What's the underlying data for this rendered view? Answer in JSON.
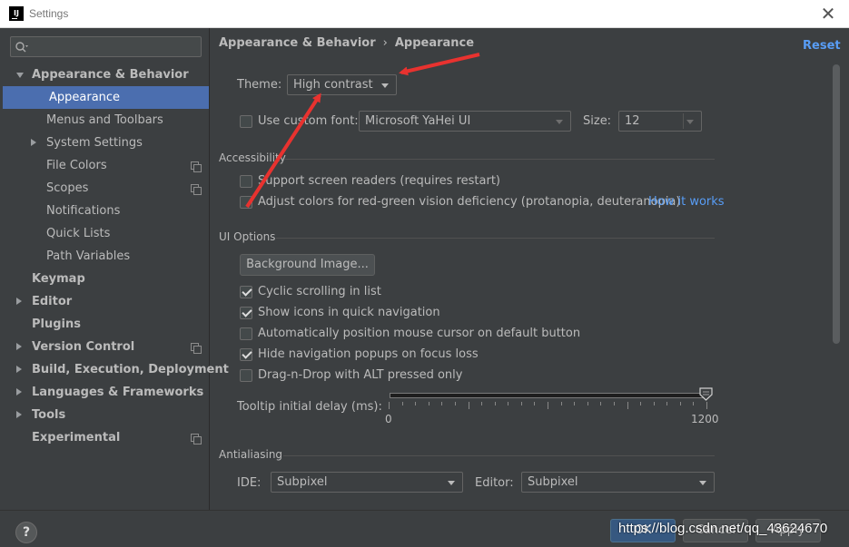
{
  "window": {
    "title": "Settings",
    "app_icon_text": "IJ"
  },
  "search": {
    "placeholder": ""
  },
  "sidebar": {
    "items": [
      {
        "label": "Appearance & Behavior",
        "bold": true,
        "arrow": "down",
        "indent": 0
      },
      {
        "label": "Appearance",
        "bold": false,
        "selected": true,
        "indent": 1
      },
      {
        "label": "Menus and Toolbars",
        "bold": false,
        "indent": 1
      },
      {
        "label": "System Settings",
        "bold": false,
        "arrow": "right",
        "indent": 1
      },
      {
        "label": "File Colors",
        "bold": false,
        "indent": 1,
        "project_icon": true
      },
      {
        "label": "Scopes",
        "bold": false,
        "indent": 1,
        "project_icon": true
      },
      {
        "label": "Notifications",
        "bold": false,
        "indent": 1
      },
      {
        "label": "Quick Lists",
        "bold": false,
        "indent": 1
      },
      {
        "label": "Path Variables",
        "bold": false,
        "indent": 1
      },
      {
        "label": "Keymap",
        "bold": true,
        "indent": 0
      },
      {
        "label": "Editor",
        "bold": true,
        "arrow": "right",
        "indent": 0
      },
      {
        "label": "Plugins",
        "bold": true,
        "indent": 0
      },
      {
        "label": "Version Control",
        "bold": true,
        "arrow": "right",
        "indent": 0,
        "project_icon": true
      },
      {
        "label": "Build, Execution, Deployment",
        "bold": true,
        "arrow": "right",
        "indent": 0
      },
      {
        "label": "Languages & Frameworks",
        "bold": true,
        "arrow": "right",
        "indent": 0
      },
      {
        "label": "Tools",
        "bold": true,
        "arrow": "right",
        "indent": 0
      },
      {
        "label": "Experimental",
        "bold": true,
        "indent": 0,
        "project_icon": true
      }
    ]
  },
  "breadcrumb": {
    "parent": "Appearance & Behavior",
    "separator": "›",
    "current": "Appearance"
  },
  "reset_label": "Reset",
  "theme": {
    "label": "Theme:",
    "value": "High contrast"
  },
  "custom_font": {
    "label": "Use custom font:",
    "checked": false,
    "value": "Microsoft YaHei UI",
    "size_label": "Size:",
    "size_value": "12"
  },
  "accessibility": {
    "title": "Accessibility",
    "screen_readers": {
      "label": "Support screen readers (requires restart)",
      "checked": false
    },
    "color_adjust": {
      "label": "Adjust colors for red-green vision deficiency (protanopia, deuteranopia)",
      "checked": false
    },
    "how_it_works": "How it works"
  },
  "ui_options": {
    "title": "UI Options",
    "background_image_button": "Background Image...",
    "options": [
      {
        "label": "Cyclic scrolling in list",
        "checked": true
      },
      {
        "label": "Show icons in quick navigation",
        "checked": true
      },
      {
        "label": "Automatically position mouse cursor on default button",
        "checked": false
      },
      {
        "label": "Hide navigation popups on focus loss",
        "checked": true
      },
      {
        "label": "Drag-n-Drop with ALT pressed only",
        "checked": false
      }
    ],
    "tooltip_delay": {
      "label": "Tooltip initial delay (ms):",
      "min_label": "0",
      "max_label": "1200",
      "value": 1200,
      "min": 0,
      "max": 1200
    }
  },
  "antialiasing": {
    "title": "Antialiasing",
    "ide_label": "IDE:",
    "ide_value": "Subpixel",
    "editor_label": "Editor:",
    "editor_value": "Subpixel"
  },
  "footer": {
    "help_label": "?",
    "ok_label": "OK",
    "cancel_label": "Cancel",
    "apply_label": "Apply",
    "watermark": "https://blog.csdn.net/qq_43624670"
  },
  "colors": {
    "background": "#3c3f41",
    "selection": "#4b6eaf",
    "link": "#589df6",
    "annotation_arrow": "#e8322f"
  }
}
